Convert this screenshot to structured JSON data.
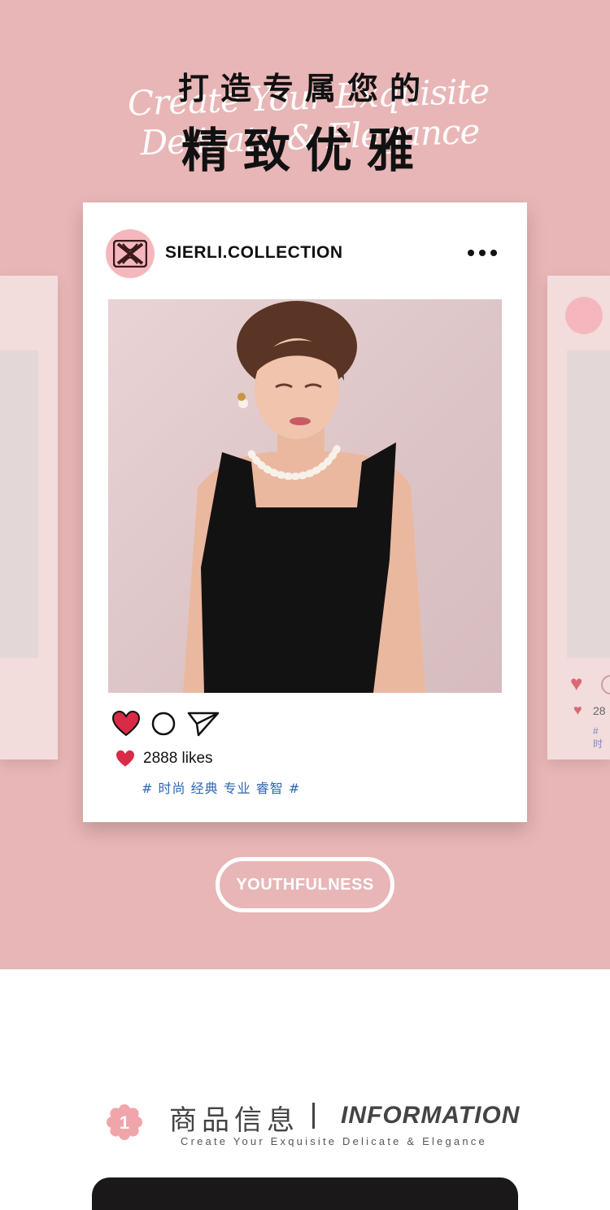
{
  "hero": {
    "script_text": "Create Your Exquisite Delicate & Elegance",
    "title_small": "打造专属您的",
    "title_big": "精致优雅"
  },
  "post": {
    "username": "SIERLI.COLLECTION",
    "likes": "2888 likes",
    "tags": "# 时尚 经典 专业 睿智 #",
    "icons": [
      "heart-icon",
      "comment-icon",
      "share-icon",
      "more-icon"
    ]
  },
  "side_card": {
    "likes_partial": "28",
    "tag_partial": "# 时"
  },
  "button": {
    "label": "YOUTHFULNESS"
  },
  "info": {
    "number": "1",
    "title_cn": "商品信息",
    "title_en": "INFORMATION",
    "subtitle": "Create Your Exquisite Delicate & Elegance"
  },
  "colors": {
    "pink_bg": "#e8b6b7",
    "heart_red": "#d92a46",
    "tag_blue": "#2d66b3",
    "logo_pink": "#f5b7bd"
  }
}
